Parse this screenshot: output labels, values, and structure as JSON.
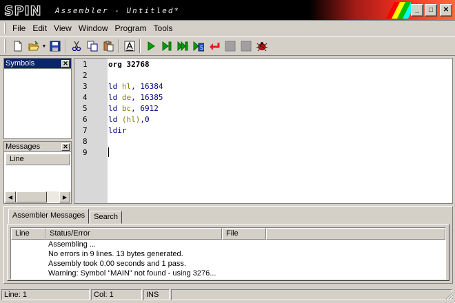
{
  "window": {
    "logo_text": "SPIN",
    "title": "Assembler - Untitled*",
    "controls": {
      "minimize": "_",
      "maximize": "□",
      "close": "✕"
    }
  },
  "menu": [
    "File",
    "Edit",
    "View",
    "Window",
    "Program",
    "Tools"
  ],
  "toolbar": {
    "icons": [
      "new-file-icon",
      "open-file-icon",
      "save-icon",
      "cut-icon",
      "copy-icon",
      "paste-icon",
      "text-style-icon",
      "run-icon",
      "step-icon",
      "step-over-icon",
      "step-out-icon",
      "return-icon",
      "stop-icon",
      "pause-icon",
      "bug-icon"
    ]
  },
  "symbols_panel": {
    "title": "Symbols"
  },
  "messages_panel": {
    "title": "Messages",
    "column": "Line"
  },
  "editor": {
    "line_numbers": [
      "1",
      "2",
      "3",
      "4",
      "5",
      "6",
      "7",
      "8",
      "9"
    ],
    "lines": [
      {
        "mnemonic": "org",
        "operands": " 32768",
        "style": "dir"
      },
      {
        "mnemonic": "",
        "operands": "",
        "style": ""
      },
      {
        "mnemonic": "ld",
        "reg": " hl",
        "operands": ", 16384",
        "style": "kw"
      },
      {
        "mnemonic": "ld",
        "reg": " de",
        "operands": ", 16385",
        "style": "kw"
      },
      {
        "mnemonic": "ld",
        "reg": " bc",
        "operands": ", 6912",
        "style": "kw"
      },
      {
        "mnemonic": "ld",
        "reg": " (hl)",
        "operands": ",0",
        "style": "kw"
      },
      {
        "mnemonic": "ldir",
        "operands": "",
        "style": "kw"
      },
      {
        "mnemonic": "",
        "operands": "",
        "style": ""
      },
      {
        "mnemonic": "",
        "operands": "",
        "style": ""
      }
    ]
  },
  "bottom_panel": {
    "tabs": [
      "Assembler Messages",
      "Search"
    ],
    "columns": [
      "Line",
      "Status/Error",
      "File"
    ],
    "rows": [
      "Assembling ...",
      "No errors in 9 lines. 13 bytes generated.",
      "Assembly took 0.00 seconds and 1 pass.",
      "Warning: Symbol \"MAIN\" not found - using 3276..."
    ]
  },
  "status": {
    "line": "Line: 1",
    "col": "Col: 1",
    "mode": "INS"
  },
  "colors": {
    "title_gradient_end": "#ff6a3a",
    "keyword": "#000080",
    "register": "#808000"
  }
}
